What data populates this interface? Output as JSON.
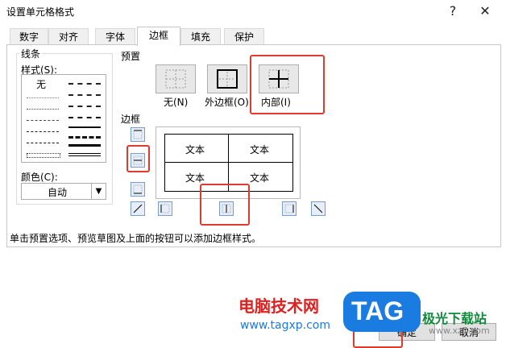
{
  "window": {
    "title": "设置单元格格式",
    "help_label": "?",
    "close_label": "✕"
  },
  "tabs": [
    "数字",
    "对齐",
    "字体",
    "边框",
    "填充",
    "保护"
  ],
  "active_tab": "边框",
  "line": {
    "group_label": "线条",
    "style_label": "样式(S):",
    "none_label": "无",
    "color_label": "颜色(C):",
    "color_value": "自动"
  },
  "presets": {
    "group_label": "预置",
    "items": [
      {
        "label": "无(N)",
        "icon": "border-none-icon"
      },
      {
        "label": "外边框(O)",
        "icon": "border-outline-icon"
      },
      {
        "label": "内部(I)",
        "icon": "border-inside-icon"
      }
    ]
  },
  "border": {
    "group_label": "边框",
    "cells": [
      "文本",
      "文本",
      "文本",
      "文本"
    ]
  },
  "hint_text": "单击预置选项、预览草图及上面的按钮可以添加边框样式。",
  "buttons": {
    "ok": "确定",
    "cancel": "取消"
  },
  "watermark": {
    "site_name": "电脑技术网",
    "url": "www.tagxp.com",
    "logo": "TAG",
    "right_text": "极光下载站",
    "right_url": "www.xz7.com"
  },
  "colors": {
    "highlight": "#e03a2f",
    "watermark_red": "#e02020",
    "watermark_blue": "#1a7be0"
  }
}
